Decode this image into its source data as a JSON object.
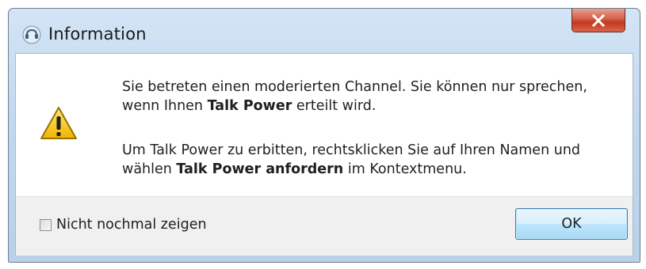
{
  "window": {
    "title": "Information",
    "app_icon": "teamspeak-icon",
    "close_icon": "close-icon"
  },
  "message": {
    "icon": "warning-icon",
    "line1": "Sie betreten einen moderierten Channel. Sie können nur sprechen,",
    "line2_before": "wenn Ihnen ",
    "line2_bold": "Talk Power",
    "line2_after": " erteilt wird.",
    "line3": "Um Talk Power zu erbitten, rechtsklicken Sie auf Ihren Namen und",
    "line4_before": "wählen ",
    "line4_bold": "Talk Power anfordern",
    "line4_after": " im Kontextmenu."
  },
  "footer": {
    "checkbox_label": "Nicht nochmal zeigen",
    "checkbox_checked": false,
    "ok_label": "OK"
  },
  "colors": {
    "close_button": "#c2381e",
    "ok_button_border": "#3c7fb1",
    "warning_yellow": "#f5c400"
  }
}
